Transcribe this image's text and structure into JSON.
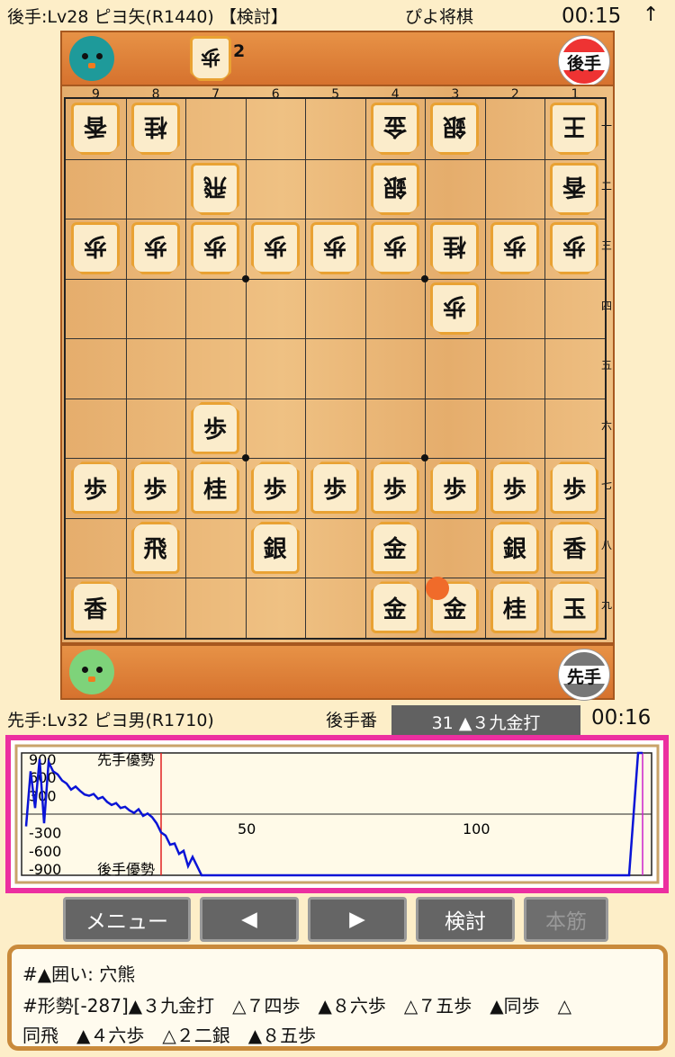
{
  "header": {
    "opponent": "後手:Lv28 ピヨ矢(R1440) 【検討】",
    "app_title": "ぴよ将棋",
    "gote_clock": "00:15",
    "arrow": "↑"
  },
  "gote_panel": {
    "hand_piece": "歩",
    "hand_count": "2",
    "badge": "後手"
  },
  "sente_panel": {
    "badge": "先手"
  },
  "columns": [
    "9",
    "8",
    "7",
    "6",
    "5",
    "4",
    "3",
    "2",
    "1"
  ],
  "rows": [
    "一",
    "二",
    "三",
    "四",
    "五",
    "六",
    "七",
    "八",
    "九"
  ],
  "pieces": [
    {
      "c": 9,
      "r": 1,
      "k": "香",
      "g": true
    },
    {
      "c": 8,
      "r": 1,
      "k": "桂",
      "g": true
    },
    {
      "c": 4,
      "r": 1,
      "k": "金",
      "g": true
    },
    {
      "c": 3,
      "r": 1,
      "k": "銀",
      "g": true
    },
    {
      "c": 1,
      "r": 1,
      "k": "王",
      "g": true
    },
    {
      "c": 7,
      "r": 2,
      "k": "飛",
      "g": true
    },
    {
      "c": 4,
      "r": 2,
      "k": "銀",
      "g": true
    },
    {
      "c": 1,
      "r": 2,
      "k": "香",
      "g": true
    },
    {
      "c": 9,
      "r": 3,
      "k": "歩",
      "g": true
    },
    {
      "c": 8,
      "r": 3,
      "k": "歩",
      "g": true
    },
    {
      "c": 7,
      "r": 3,
      "k": "歩",
      "g": true
    },
    {
      "c": 6,
      "r": 3,
      "k": "歩",
      "g": true
    },
    {
      "c": 5,
      "r": 3,
      "k": "歩",
      "g": true
    },
    {
      "c": 4,
      "r": 3,
      "k": "歩",
      "g": true
    },
    {
      "c": 3,
      "r": 3,
      "k": "桂",
      "g": true
    },
    {
      "c": 2,
      "r": 3,
      "k": "歩",
      "g": true
    },
    {
      "c": 1,
      "r": 3,
      "k": "歩",
      "g": true
    },
    {
      "c": 3,
      "r": 4,
      "k": "歩",
      "g": true
    },
    {
      "c": 7,
      "r": 6,
      "k": "歩",
      "g": false
    },
    {
      "c": 9,
      "r": 7,
      "k": "歩",
      "g": false
    },
    {
      "c": 8,
      "r": 7,
      "k": "歩",
      "g": false
    },
    {
      "c": 7,
      "r": 7,
      "k": "桂",
      "g": false
    },
    {
      "c": 6,
      "r": 7,
      "k": "歩",
      "g": false
    },
    {
      "c": 5,
      "r": 7,
      "k": "歩",
      "g": false
    },
    {
      "c": 4,
      "r": 7,
      "k": "歩",
      "g": false
    },
    {
      "c": 3,
      "r": 7,
      "k": "歩",
      "g": false
    },
    {
      "c": 2,
      "r": 7,
      "k": "歩",
      "g": false
    },
    {
      "c": 1,
      "r": 7,
      "k": "歩",
      "g": false
    },
    {
      "c": 8,
      "r": 8,
      "k": "飛",
      "g": false
    },
    {
      "c": 6,
      "r": 8,
      "k": "銀",
      "g": false
    },
    {
      "c": 4,
      "r": 8,
      "k": "金",
      "g": false
    },
    {
      "c": 2,
      "r": 8,
      "k": "銀",
      "g": false
    },
    {
      "c": 1,
      "r": 8,
      "k": "香",
      "g": false
    },
    {
      "c": 9,
      "r": 9,
      "k": "香",
      "g": false
    },
    {
      "c": 4,
      "r": 9,
      "k": "金",
      "g": false
    },
    {
      "c": 3,
      "r": 9,
      "k": "金",
      "g": false
    },
    {
      "c": 2,
      "r": 9,
      "k": "桂",
      "g": false
    },
    {
      "c": 1,
      "r": 9,
      "k": "玉",
      "g": false
    }
  ],
  "last_move_square": {
    "c": 3,
    "r": 9
  },
  "status": {
    "sente": "先手:Lv32 ピヨ男(R1710)",
    "turn": "後手番",
    "move": "31 ▲３九金打",
    "sente_clock": "00:16"
  },
  "chart_data": {
    "type": "line",
    "yticks": [
      "900",
      "600",
      "300",
      "-300",
      "-600",
      "-900"
    ],
    "ylim": [
      -1000,
      1000
    ],
    "xticks": [
      "50",
      "100"
    ],
    "labels": {
      "sente_adv": "先手優勢",
      "gote_adv": "後手優勢"
    },
    "current_move": 31,
    "cursor_move": 138,
    "x": [
      1,
      2,
      3,
      4,
      5,
      6,
      7,
      8,
      9,
      10,
      11,
      12,
      13,
      14,
      15,
      16,
      17,
      18,
      19,
      20,
      21,
      22,
      23,
      24,
      25,
      26,
      27,
      28,
      29,
      30,
      31,
      32,
      33,
      34,
      35,
      36,
      37,
      38,
      40,
      45,
      60,
      80,
      100,
      120,
      130,
      135,
      136,
      137,
      138
    ],
    "y": [
      -200,
      700,
      100,
      900,
      -150,
      850,
      700,
      650,
      550,
      500,
      400,
      450,
      380,
      320,
      300,
      330,
      250,
      280,
      200,
      150,
      180,
      100,
      120,
      60,
      20,
      80,
      -30,
      10,
      -50,
      -150,
      -300,
      -350,
      -500,
      -480,
      -650,
      -600,
      -850,
      -700,
      -1000,
      -1000,
      -1000,
      -1000,
      -1000,
      -1000,
      -1000,
      -1000,
      0,
      1000,
      1000
    ],
    "colors": {
      "line": "#0a14d6",
      "current": "#e02020",
      "cursor": "#cc22cc"
    }
  },
  "buttons": [
    "メニュー",
    "◀",
    "▶",
    "検討",
    "本筋"
  ],
  "comment": [
    "#▲囲い: 穴熊",
    "#形勢[-287]▲３九金打　△７四歩　▲８六歩　△７五歩　▲同歩　△",
    "同飛　▲４六歩　△２二銀　▲８五歩"
  ]
}
